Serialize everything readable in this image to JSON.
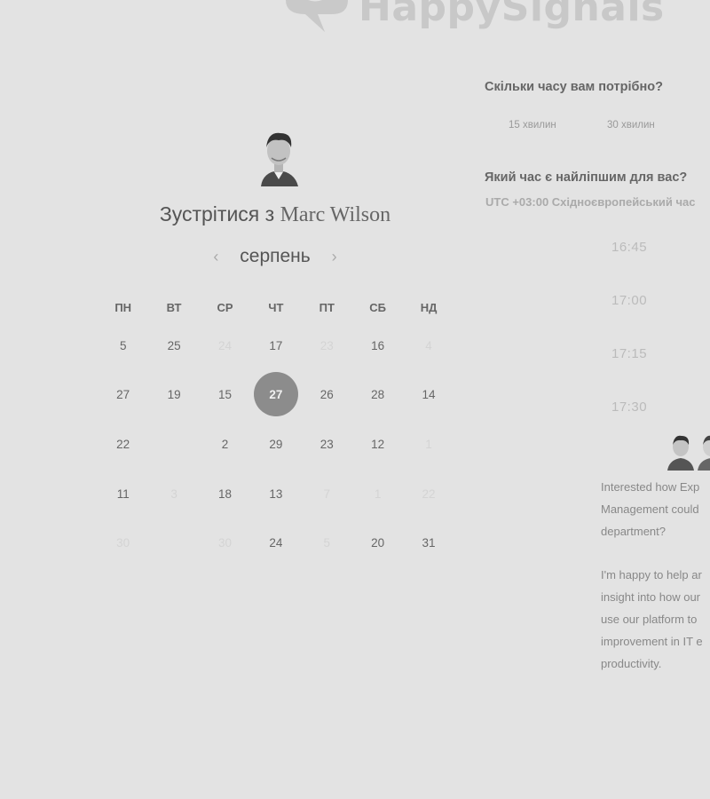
{
  "brand": {
    "name": "HappySignals"
  },
  "host": {
    "title_prefix": "Зустрітися з",
    "name": "Marc Wilson"
  },
  "calendar": {
    "month": "серпень",
    "prev_icon": "chevron-left-icon",
    "next_icon": "chevron-right-icon",
    "weekdays": [
      "ПН",
      "ВТ",
      "СР",
      "ЧТ",
      "ПТ",
      "СБ",
      "НД"
    ],
    "weeks": [
      [
        {
          "d": "5"
        },
        {
          "d": "25"
        },
        {
          "d": "24",
          "muted": true
        },
        {
          "d": "17"
        },
        {
          "d": "23",
          "muted": true
        },
        {
          "d": "16"
        },
        {
          "d": "4",
          "muted": true
        }
      ],
      [
        {
          "d": "27"
        },
        {
          "d": "19"
        },
        {
          "d": "15"
        },
        {
          "d": "27",
          "selected": true
        },
        {
          "d": "26"
        },
        {
          "d": "28"
        },
        {
          "d": "14"
        }
      ],
      [
        {
          "d": "22"
        },
        {
          "d": ""
        },
        {
          "d": "2"
        },
        {
          "d": "29"
        },
        {
          "d": "23"
        },
        {
          "d": "12"
        },
        {
          "d": "1",
          "muted": true
        }
      ],
      [
        {
          "d": "11"
        },
        {
          "d": "3",
          "muted": true
        },
        {
          "d": "18"
        },
        {
          "d": "13"
        },
        {
          "d": "7",
          "muted": true
        },
        {
          "d": "1",
          "muted": true
        },
        {
          "d": "22",
          "muted": true
        }
      ],
      [
        {
          "d": "30",
          "muted": true
        },
        {
          "d": ""
        },
        {
          "d": "30",
          "muted": true
        },
        {
          "d": "24"
        },
        {
          "d": "5",
          "muted": true
        },
        {
          "d": "20"
        },
        {
          "d": "31"
        }
      ]
    ],
    "colors": {
      "selected_bg": "#8c8c8c",
      "background": "#e3e3e3"
    }
  },
  "duration": {
    "question": "Скільки часу вам потрібно?",
    "options": [
      "15 хвилин",
      "30 хвилин"
    ]
  },
  "time": {
    "question": "Який час є найліпшим для вас?",
    "timezone": "UTC +03:00 Східноєвропейський час",
    "slots": [
      "16:45",
      "17:00",
      "17:15",
      "17:30"
    ]
  },
  "blurb": {
    "p1": [
      "Interested how Exp",
      "Management could",
      "department?"
    ],
    "p2": [
      "I'm happy to help ar",
      "insight into how our",
      "use our platform to",
      "improvement in IT e",
      "productivity."
    ]
  }
}
